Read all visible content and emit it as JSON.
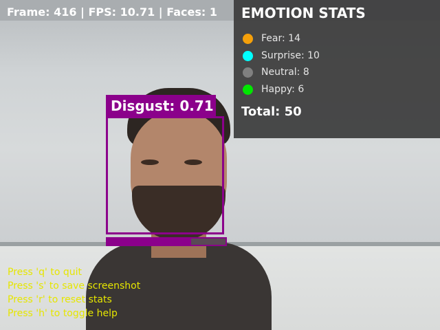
{
  "status": {
    "text": "Frame: 416 | FPS: 10.71 | Faces: 1"
  },
  "detection": {
    "label": "Disgust: 0.71",
    "confidence": 0.71,
    "box_color": "#8b008b"
  },
  "stats": {
    "title": "EMOTION STATS",
    "items": [
      {
        "label": "Fear: 14",
        "color": "#f5a00a"
      },
      {
        "label": "Surprise: 10",
        "color": "#00ffff"
      },
      {
        "label": "Neutral: 8",
        "color": "#808080"
      },
      {
        "label": "Happy: 6",
        "color": "#00e600"
      }
    ],
    "total": "Total: 50"
  },
  "help": {
    "lines": [
      "Press 'q' to quit",
      "Press 's' to save screenshot",
      "Press 'r' to reset stats",
      "Press 'h' to toggle help"
    ]
  }
}
